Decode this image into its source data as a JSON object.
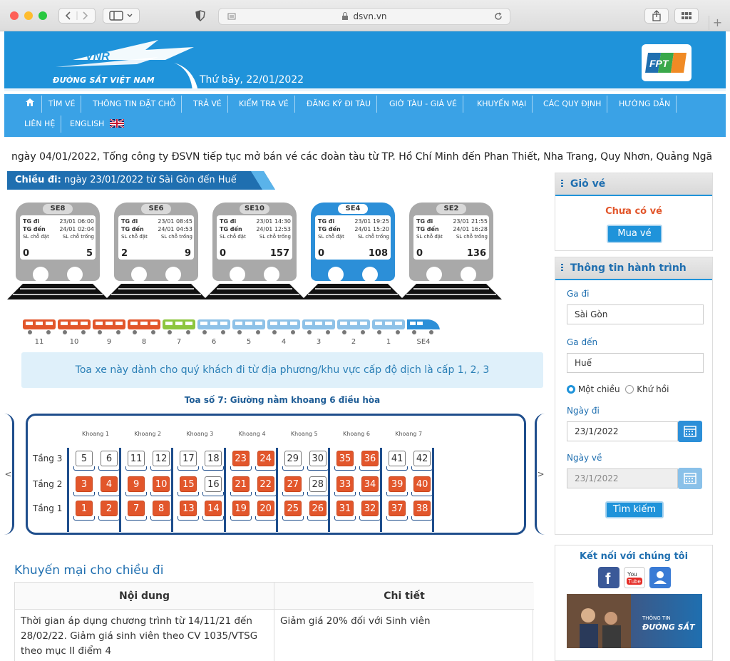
{
  "browser": {
    "url": "dsvn.vn"
  },
  "header": {
    "logo_text": "ĐƯỜNG SẮT VIỆT NAM",
    "logo_mark": "VNR",
    "date": "Thứ bảy, 22/01/2022",
    "partner_logo": "FPT"
  },
  "nav": {
    "items": [
      "TÌM VÉ",
      "THÔNG TIN ĐẶT CHỖ",
      "TRẢ VÉ",
      "KIỂM TRA VÉ",
      "ĐĂNG KÝ ĐI TÀU",
      "GIỜ TÀU - GIÁ VÉ",
      "KHUYẾN MẠI",
      "CÁC QUY ĐỊNH",
      "HƯỚNG DẪN",
      "LIÊN HỆ",
      "ENGLISH"
    ]
  },
  "marquee": "ngày 04/01/2022, Tổng công ty ĐSVN tiếp tục mở bán vé các đoàn tàu từ TP. Hồ Chí Minh đến Phan Thiết, Nha Trang, Quy Nhơn, Quảng Ngã",
  "trip": {
    "direction_label": "Chiều đi:",
    "description": "ngày 23/01/2022 từ Sài Gòn đến Huế"
  },
  "train_labels": {
    "dep": "TG đi",
    "arr": "TG đến",
    "booked": "SL chỗ đặt",
    "free": "SL chỗ trống"
  },
  "trains": [
    {
      "name": "SE8",
      "dep": "23/01 06:00",
      "arr": "24/01 02:04",
      "booked": "0",
      "free": "5",
      "selected": false
    },
    {
      "name": "SE6",
      "dep": "23/01 08:45",
      "arr": "24/01 04:53",
      "booked": "2",
      "free": "9",
      "selected": false
    },
    {
      "name": "SE10",
      "dep": "23/01 14:30",
      "arr": "24/01 12:53",
      "booked": "0",
      "free": "157",
      "selected": false
    },
    {
      "name": "SE4",
      "dep": "23/01 19:25",
      "arr": "24/01 15:20",
      "booked": "0",
      "free": "108",
      "selected": true
    },
    {
      "name": "SE2",
      "dep": "23/01 21:55",
      "arr": "24/01 16:28",
      "booked": "0",
      "free": "136",
      "selected": false
    }
  ],
  "cars": [
    {
      "label": "11",
      "color": "#e2562b"
    },
    {
      "label": "10",
      "color": "#e2562b"
    },
    {
      "label": "9",
      "color": "#e2562b"
    },
    {
      "label": "8",
      "color": "#e2562b"
    },
    {
      "label": "7",
      "color": "#8dc63f"
    },
    {
      "label": "6",
      "color": "#8ec2e8"
    },
    {
      "label": "5",
      "color": "#8ec2e8"
    },
    {
      "label": "4",
      "color": "#8ec2e8"
    },
    {
      "label": "3",
      "color": "#8ec2e8"
    },
    {
      "label": "2",
      "color": "#8ec2e8"
    },
    {
      "label": "1",
      "color": "#8ec2e8"
    },
    {
      "label": "SE4",
      "color": "#2c8fd8"
    }
  ],
  "notice": "Toa xe này dành cho quý khách đi từ địa phương/khu vực cấp độ dịch là cấp 1, 2, 3",
  "coach": {
    "title": "Toa số 7: Giường nằm khoang 6 điều hòa",
    "compartments": [
      "Khoang 1",
      "Khoang 2",
      "Khoang 3",
      "Khoang 4",
      "Khoang 5",
      "Khoang 6",
      "Khoang 7"
    ],
    "floors": [
      "Tầng 3",
      "Tầng 2",
      "Tầng 1"
    ],
    "rows": [
      [
        {
          "n": "5",
          "booked": false
        },
        {
          "n": "6",
          "booked": false
        },
        {
          "n": "11",
          "booked": false
        },
        {
          "n": "12",
          "booked": false
        },
        {
          "n": "17",
          "booked": false
        },
        {
          "n": "18",
          "booked": false
        },
        {
          "n": "23",
          "booked": true
        },
        {
          "n": "24",
          "booked": true
        },
        {
          "n": "29",
          "booked": false
        },
        {
          "n": "30",
          "booked": false
        },
        {
          "n": "35",
          "booked": true
        },
        {
          "n": "36",
          "booked": true
        },
        {
          "n": "41",
          "booked": false
        },
        {
          "n": "42",
          "booked": false
        }
      ],
      [
        {
          "n": "3",
          "booked": true
        },
        {
          "n": "4",
          "booked": true
        },
        {
          "n": "9",
          "booked": true
        },
        {
          "n": "10",
          "booked": true
        },
        {
          "n": "15",
          "booked": true
        },
        {
          "n": "16",
          "booked": false
        },
        {
          "n": "21",
          "booked": true
        },
        {
          "n": "22",
          "booked": true
        },
        {
          "n": "27",
          "booked": true
        },
        {
          "n": "28",
          "booked": false
        },
        {
          "n": "33",
          "booked": true
        },
        {
          "n": "34",
          "booked": true
        },
        {
          "n": "39",
          "booked": true
        },
        {
          "n": "40",
          "booked": true
        }
      ],
      [
        {
          "n": "1",
          "booked": true
        },
        {
          "n": "2",
          "booked": true
        },
        {
          "n": "7",
          "booked": true
        },
        {
          "n": "8",
          "booked": true
        },
        {
          "n": "13",
          "booked": true
        },
        {
          "n": "14",
          "booked": true
        },
        {
          "n": "19",
          "booked": true
        },
        {
          "n": "20",
          "booked": true
        },
        {
          "n": "25",
          "booked": true
        },
        {
          "n": "26",
          "booked": true
        },
        {
          "n": "31",
          "booked": true
        },
        {
          "n": "32",
          "booked": true
        },
        {
          "n": "37",
          "booked": true
        },
        {
          "n": "38",
          "booked": true
        }
      ]
    ],
    "prev": "<",
    "next": ">"
  },
  "promo": {
    "title": "Khuyến mại cho chiều đi",
    "col_content": "Nội dung",
    "col_detail": "Chi tiết",
    "row_content": "Thời gian áp dụng chương trình từ 14/11/21 đến 28/02/22. Giảm giá sinh viên theo CV 1035/VTSG theo mục II điểm 4",
    "row_detail": "Giảm giá 20% đối với Sinh viên"
  },
  "cart": {
    "title": "Giỏ vé",
    "empty": "Chưa có vé",
    "buy": "Mua vé"
  },
  "search": {
    "title": "Thông tin hành trình",
    "from_label": "Ga đi",
    "from": "Sài Gòn",
    "to_label": "Ga đến",
    "to": "Huế",
    "one_way": "Một chiều",
    "round_trip": "Khứ hồi",
    "dep_label": "Ngày đi",
    "dep": "23/1/2022",
    "ret_label": "Ngày về",
    "ret": "23/1/2022",
    "submit": "Tìm kiếm"
  },
  "social": {
    "title": "Kết nối với chúng tôi",
    "ad_line1": "THÔNG TIN",
    "ad_line2": "ĐƯỜNG SẮT"
  },
  "colors": {
    "brand": "#1f93da",
    "booked": "#e2562b",
    "selected_train": "#2c8fd8",
    "train_grey": "#a9a9a9",
    "dark_blue": "#1f4e8c"
  }
}
